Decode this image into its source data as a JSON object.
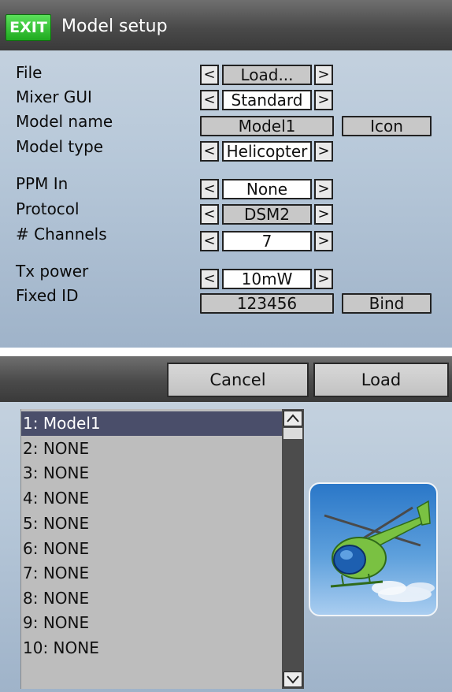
{
  "header": {
    "exit_label": "EXIT",
    "title": "Model setup"
  },
  "settings": {
    "rows": [
      {
        "label": "File",
        "value": "Load..."
      },
      {
        "label": "Mixer GUI",
        "value": "Standard"
      },
      {
        "label": "Model name",
        "value": "Model1",
        "extra_button": "Icon"
      },
      {
        "label": "Model type",
        "value": "Helicopter"
      },
      {
        "label": "PPM In",
        "value": "None"
      },
      {
        "label": "Protocol",
        "value": "DSM2"
      },
      {
        "label": "# Channels",
        "value": "7"
      },
      {
        "label": "Tx power",
        "value": "10mW"
      },
      {
        "label": "Fixed ID",
        "value": "123456",
        "extra_button": "Bind"
      }
    ],
    "left_arrow": "<",
    "right_arrow": ">"
  },
  "dialog": {
    "cancel_label": "Cancel",
    "load_label": "Load",
    "items": [
      "1: Model1",
      "2: NONE",
      "3: NONE",
      "4: NONE",
      "5: NONE",
      "6: NONE",
      "7: NONE",
      "8: NONE",
      "9: NONE",
      "10: NONE"
    ],
    "selected_index": 0,
    "preview_icon": "helicopter-icon"
  },
  "colors": {
    "titlebar": "#4a4a4a",
    "exit_green": "#1faa1f",
    "selection": "#4a4e6a",
    "panel_bg": "#b7c8d9"
  }
}
